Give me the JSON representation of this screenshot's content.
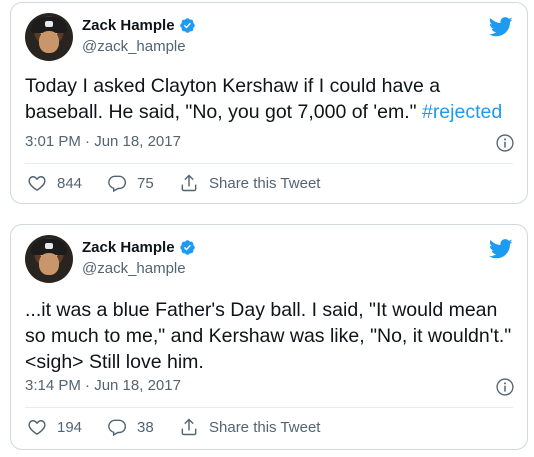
{
  "colors": {
    "link": "#1d9bf0",
    "text": "#0f1419",
    "muted": "#536471",
    "border": "#cfd9de"
  },
  "tweets": [
    {
      "author": {
        "name": "Zack Hample",
        "handle": "@zack_hample",
        "verified": true
      },
      "text_before": "Today I asked Clayton Kershaw if I could have a baseball. He said, \"No, you got 7,000 of 'em.\" ",
      "hashtag": "#rejected",
      "timestamp": "3:01 PM · Jun 18, 2017",
      "likes": "844",
      "replies": "75",
      "share_label": "Share this Tweet"
    },
    {
      "author": {
        "name": "Zack Hample",
        "handle": "@zack_hample",
        "verified": true
      },
      "text_before": "...it was a blue Father's Day ball. I said, \"It would mean so much to me,\" and Kershaw was like, \"No, it wouldn't.\" <sigh> Still love him.",
      "hashtag": "",
      "timestamp": "3:14 PM · Jun 18, 2017",
      "likes": "194",
      "replies": "38",
      "share_label": "Share this Tweet"
    }
  ],
  "icons": {
    "verified": "verified-badge-icon",
    "bird": "twitter-bird-icon",
    "info": "info-icon",
    "like": "heart-icon",
    "reply": "reply-bubble-icon",
    "share": "share-icon"
  }
}
